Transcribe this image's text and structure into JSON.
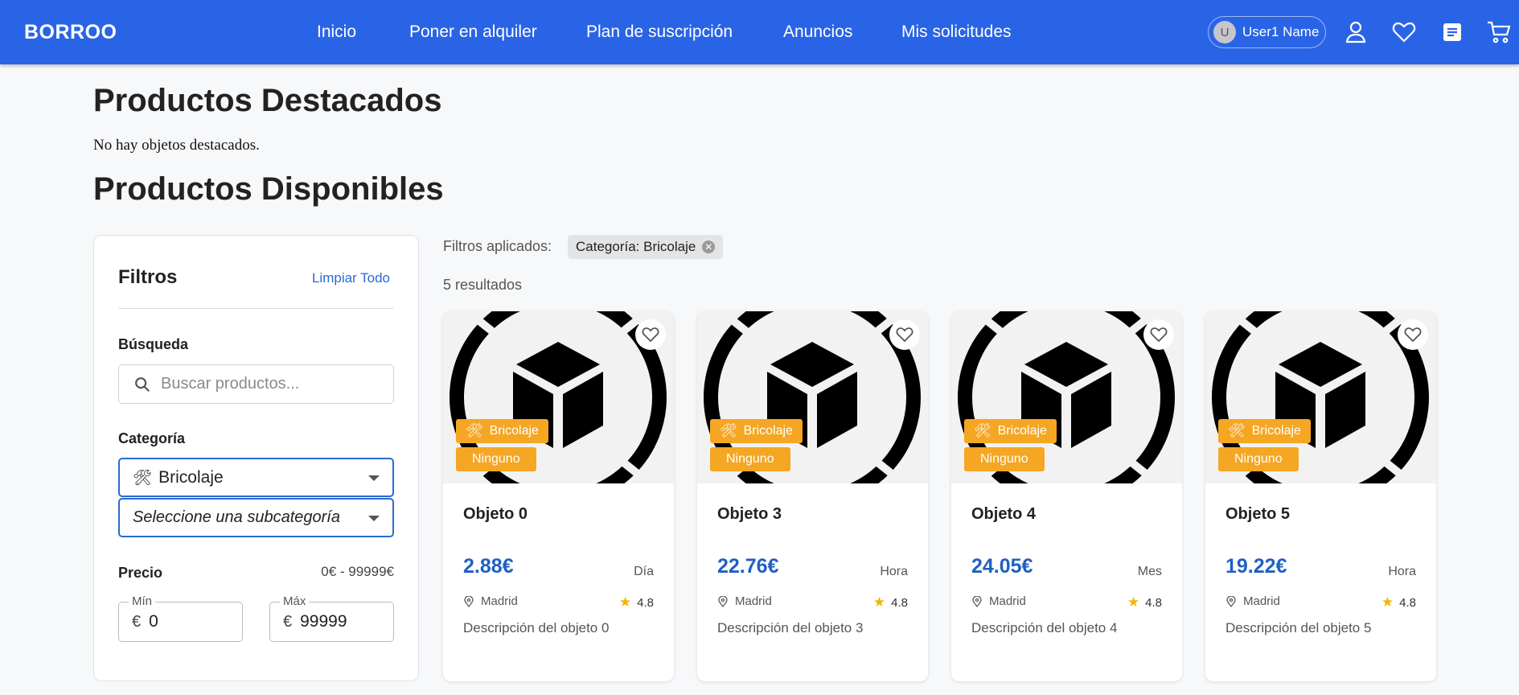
{
  "header": {
    "brand": "BORROO",
    "nav": [
      "Inicio",
      "Poner en alquiler",
      "Plan de suscripción",
      "Anuncios",
      "Mis solicitudes"
    ],
    "user": {
      "initial": "U",
      "name": "User1 Name"
    },
    "icons": [
      "user-icon",
      "heart-icon",
      "list-icon",
      "cart-icon"
    ],
    "accent": "#2a64e6"
  },
  "featured": {
    "title": "Productos Destacados",
    "empty_text": "No hay objetos destacados."
  },
  "available": {
    "title": "Productos Disponibles"
  },
  "filters": {
    "title": "Filtros",
    "clear_all": "Limpiar Todo",
    "search_label": "Búsqueda",
    "search_placeholder": "Buscar productos...",
    "category_label": "Categoría",
    "category_value": "Bricolaje",
    "subcategory_placeholder": "Seleccione una subcategoría",
    "price_label": "Precio",
    "price_range": "0€ - 99999€",
    "min_label": "Mín",
    "max_label": "Máx",
    "currency": "€",
    "min_value": "0",
    "max_value": "99999"
  },
  "results": {
    "applied_label": "Filtros aplicados:",
    "applied_chip": "Categoría: Bricolaje",
    "count_text": "5 resultados",
    "products": [
      {
        "title": "Objeto 0",
        "price": "2.88€",
        "unit": "Día",
        "location": "Madrid",
        "rating": "4.8",
        "description": "Descripción del objeto 0",
        "category": "Bricolaje",
        "subcategory": "Ninguno"
      },
      {
        "title": "Objeto 3",
        "price": "22.76€",
        "unit": "Hora",
        "location": "Madrid",
        "rating": "4.8",
        "description": "Descripción del objeto 3",
        "category": "Bricolaje",
        "subcategory": "Ninguno"
      },
      {
        "title": "Objeto 4",
        "price": "24.05€",
        "unit": "Mes",
        "location": "Madrid",
        "rating": "4.8",
        "description": "Descripción del objeto 4",
        "category": "Bricolaje",
        "subcategory": "Ninguno"
      },
      {
        "title": "Objeto 5",
        "price": "19.22€",
        "unit": "Hora",
        "location": "Madrid",
        "rating": "4.8",
        "description": "Descripción del objeto 5",
        "category": "Bricolaje",
        "subcategory": "Ninguno"
      }
    ]
  }
}
